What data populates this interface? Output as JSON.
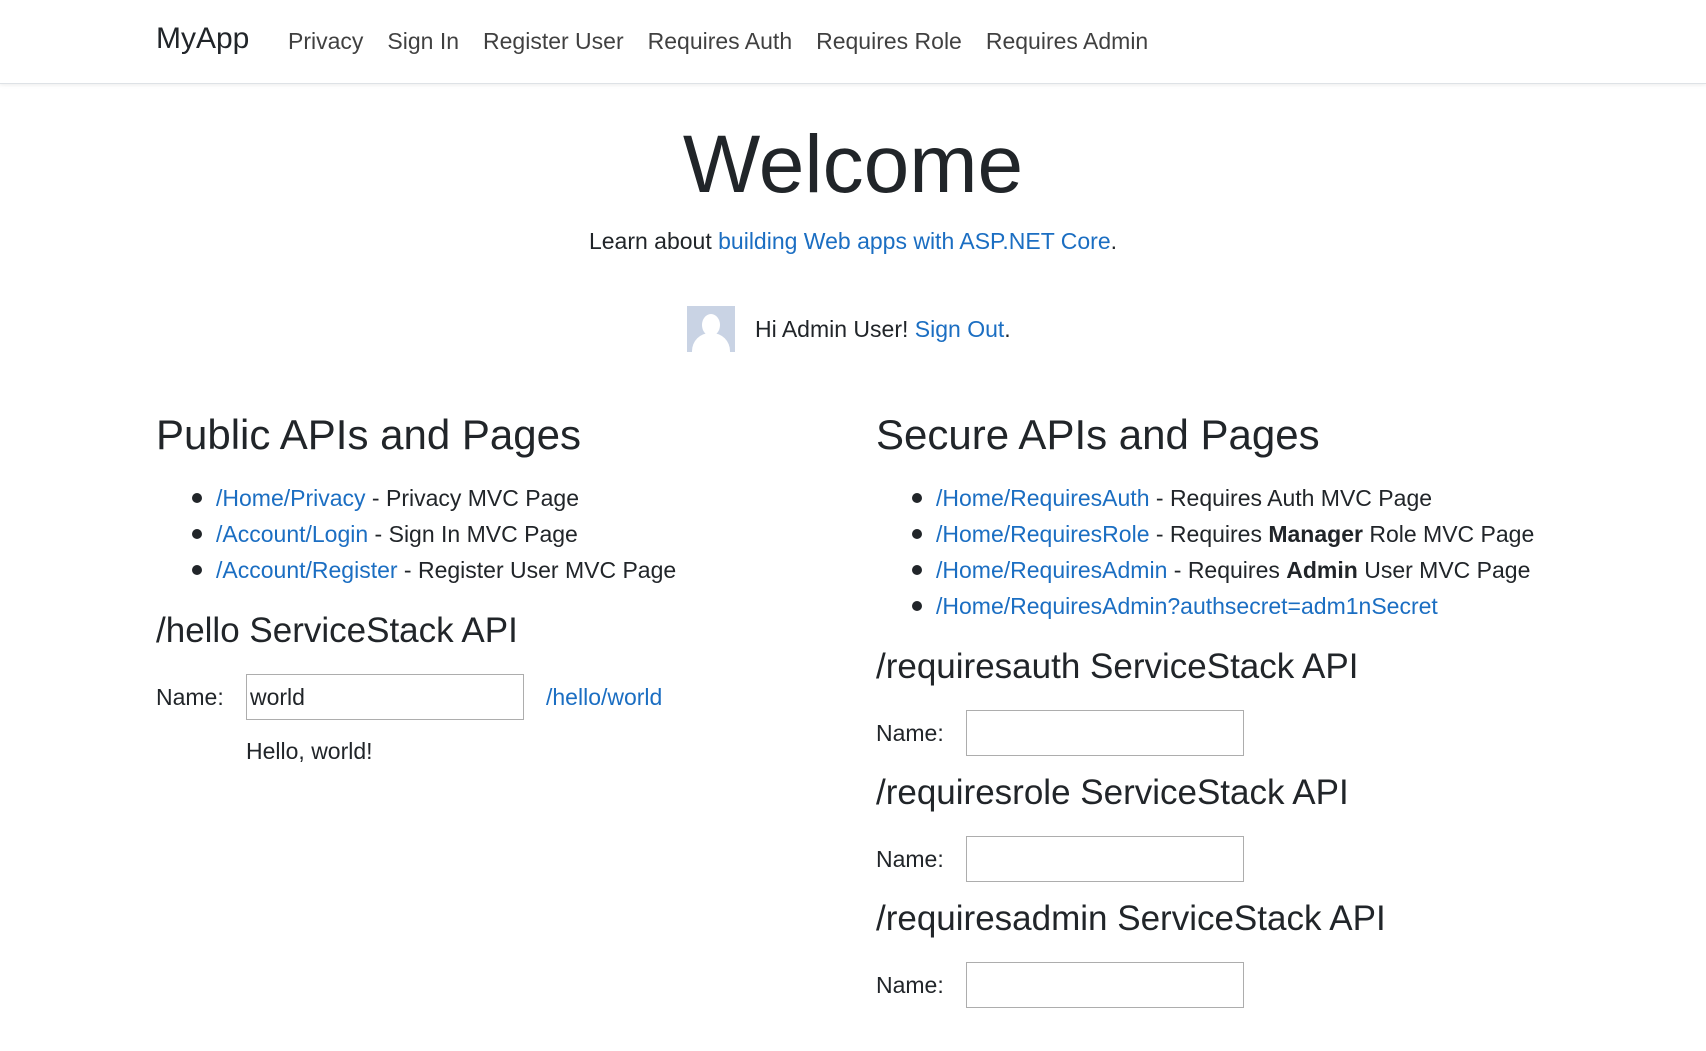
{
  "nav": {
    "brand": "MyApp",
    "links": [
      "Privacy",
      "Sign In",
      "Register User",
      "Requires Auth",
      "Requires Role",
      "Requires Admin"
    ]
  },
  "hero": {
    "title": "Welcome",
    "learn_prefix": "Learn about ",
    "learn_link": "building Web apps with ASP.NET Core",
    "learn_suffix": "."
  },
  "user": {
    "greeting": "Hi Admin User! ",
    "signout": "Sign Out",
    "suffix": "."
  },
  "public": {
    "heading": "Public APIs and Pages",
    "items": [
      {
        "link": "/Home/Privacy",
        "text": " - Privacy MVC Page"
      },
      {
        "link": "/Account/Login",
        "text": " - Sign In MVC Page"
      },
      {
        "link": "/Account/Register",
        "text": " - Register User MVC Page"
      }
    ],
    "hello": {
      "heading": "/hello ServiceStack API",
      "label": "Name:",
      "value": "world",
      "link": "/hello/world",
      "result": "Hello, world!"
    }
  },
  "secure": {
    "heading": "Secure APIs and Pages",
    "items": [
      {
        "link": "/Home/RequiresAuth",
        "pre": " - Requires Auth MVC Page",
        "bold": "",
        "post": ""
      },
      {
        "link": "/Home/RequiresRole",
        "pre": " - Requires ",
        "bold": "Manager",
        "post": " Role MVC Page"
      },
      {
        "link": "/Home/RequiresAdmin",
        "pre": " - Requires ",
        "bold": "Admin",
        "post": " User MVC Page"
      },
      {
        "link": "/Home/RequiresAdmin?authsecret=adm1nSecret",
        "pre": "",
        "bold": "",
        "post": ""
      }
    ],
    "apis": [
      {
        "heading": "/requiresauth ServiceStack API",
        "label": "Name:",
        "value": ""
      },
      {
        "heading": "/requiresrole ServiceStack API",
        "label": "Name:",
        "value": ""
      },
      {
        "heading": "/requiresadmin ServiceStack API",
        "label": "Name:",
        "value": ""
      }
    ]
  }
}
